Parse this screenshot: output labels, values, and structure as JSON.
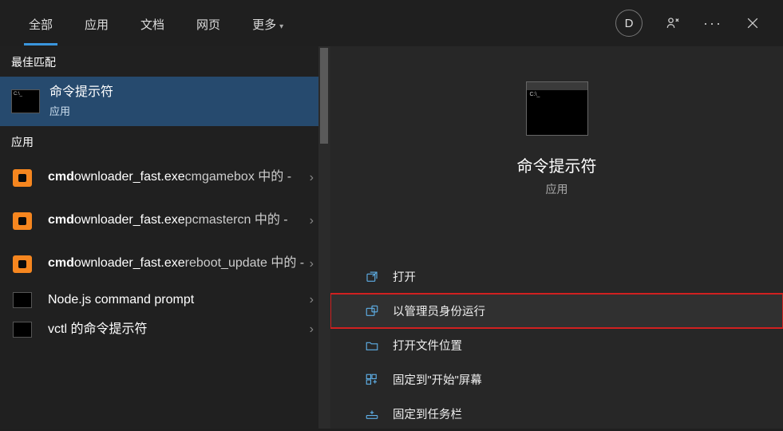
{
  "tabs": {
    "all": "全部",
    "apps": "应用",
    "docs": "文档",
    "web": "网页",
    "more": "更多"
  },
  "avatar_letter": "D",
  "sections": {
    "best_match": "最佳匹配",
    "apps": "应用"
  },
  "best_match": {
    "title": "命令提示符",
    "sub": "应用"
  },
  "apps_list": [
    {
      "prefix": "cmd",
      "rest": "ownloader_fast.exe",
      "after": "cmgamebox 中的 -"
    },
    {
      "prefix": "cmd",
      "rest": "ownloader_fast.exe",
      "after": "pcmastercn 中的 -"
    },
    {
      "prefix": "cmd",
      "rest": "ownloader_fast.exe",
      "after": "reboot_update 中的 -"
    }
  ],
  "plain_items": [
    "Node.js command prompt",
    "vctl 的命令提示符"
  ],
  "preview": {
    "title": "命令提示符",
    "sub": "应用"
  },
  "actions": {
    "open": "打开",
    "run_admin": "以管理员身份运行",
    "open_location": "打开文件位置",
    "pin_start": "固定到\"开始\"屏幕",
    "pin_taskbar": "固定到任务栏"
  }
}
